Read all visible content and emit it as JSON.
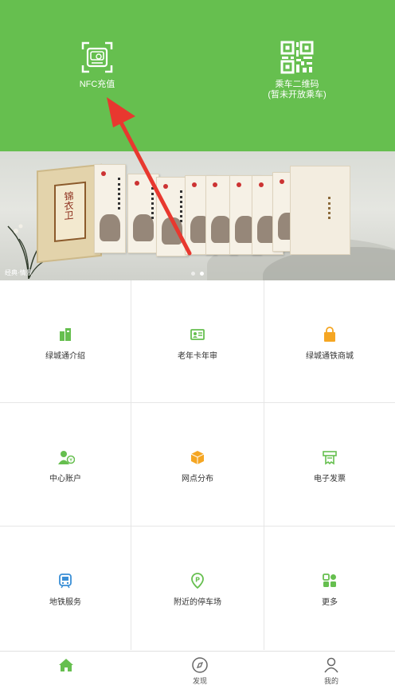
{
  "header": {
    "nfc": {
      "label": "NFC充值",
      "icon": "nfc-card-icon"
    },
    "qr": {
      "line1": "乘车二维码",
      "line2": "(暂未开放乘车)",
      "icon": "qr-code-icon"
    }
  },
  "banner": {
    "caption": "经典·情景",
    "page_count": 2,
    "active_index": 1,
    "book_title": "锦衣卫"
  },
  "grid": {
    "items": [
      {
        "label": "绿城通介绍",
        "icon": "intro-icon",
        "color": "#66bf4f"
      },
      {
        "label": "老年卡年审",
        "icon": "senior-card-icon",
        "color": "#66bf4f"
      },
      {
        "label": "绿城通铁商城",
        "icon": "shopping-bag-icon",
        "color": "#f5a623"
      },
      {
        "label": "中心账户",
        "icon": "account-icon",
        "color": "#66bf4f"
      },
      {
        "label": "网点分布",
        "icon": "outlet-box-icon",
        "color": "#f5a623"
      },
      {
        "label": "电子发票",
        "icon": "invoice-icon",
        "color": "#66bf4f"
      },
      {
        "label": "地铁服务",
        "icon": "metro-icon",
        "color": "#3a8fd6"
      },
      {
        "label": "附近的停车场",
        "icon": "parking-icon",
        "color": "#66bf4f"
      },
      {
        "label": "更多",
        "icon": "more-grid-icon",
        "color": "#66bf4f"
      }
    ]
  },
  "tabbar": {
    "items": [
      {
        "label": "",
        "icon": "home-icon",
        "active": true
      },
      {
        "label": "发现",
        "icon": "compass-icon",
        "active": false
      },
      {
        "label": "我的",
        "icon": "user-icon",
        "active": false
      }
    ]
  },
  "colors": {
    "brand": "#66bf4f",
    "arrow": "#e8382f"
  }
}
